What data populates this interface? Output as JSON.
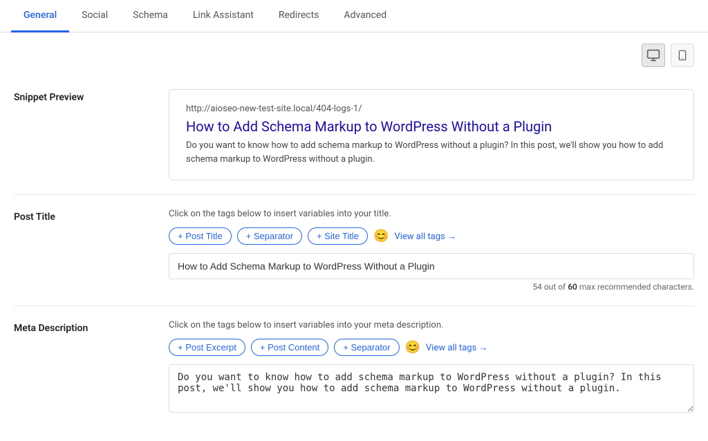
{
  "tabs": [
    {
      "id": "general",
      "label": "General",
      "active": true
    },
    {
      "id": "social",
      "label": "Social",
      "active": false
    },
    {
      "id": "schema",
      "label": "Schema",
      "active": false
    },
    {
      "id": "link-assistant",
      "label": "Link Assistant",
      "active": false
    },
    {
      "id": "redirects",
      "label": "Redirects",
      "active": false
    },
    {
      "id": "advanced",
      "label": "Advanced",
      "active": false
    }
  ],
  "device_toggle": {
    "desktop_label": "🖥",
    "mobile_label": "📱"
  },
  "snippet_preview": {
    "label": "Snippet Preview",
    "url": "http://aioseo-new-test-site.local/404-logs-1/",
    "title": "How to Add Schema Markup to WordPress Without a Plugin",
    "description": "Do you want to know how to add schema markup to WordPress without a plugin? In this post, we'll show you how to add schema markup to WordPress without a plugin."
  },
  "post_title": {
    "label": "Post Title",
    "instruction": "Click on the tags below to insert variables into your title.",
    "tags": [
      {
        "id": "post-title-tag",
        "label": "+ Post Title"
      },
      {
        "id": "separator-tag",
        "label": "+ Separator"
      },
      {
        "id": "site-title-tag",
        "label": "+ Site Title"
      }
    ],
    "view_all_label": "View all tags →",
    "emoji": "😊",
    "value": "How to Add Schema Markup to WordPress Without a Plugin",
    "char_count": "54",
    "char_max": "60",
    "char_suffix": "max recommended characters."
  },
  "meta_description": {
    "label": "Meta Description",
    "instruction": "Click on the tags below to insert variables into your meta description.",
    "tags": [
      {
        "id": "post-excerpt-tag",
        "label": "+ Post Excerpt"
      },
      {
        "id": "post-content-tag",
        "label": "+ Post Content"
      },
      {
        "id": "separator-tag2",
        "label": "+ Separator"
      }
    ],
    "view_all_label": "View all tags →",
    "emoji": "😊",
    "value": "Do you want to know how to add schema markup to WordPress without a plugin? In this post, we'll show you how to add schema markup to WordPress without a plugin."
  }
}
